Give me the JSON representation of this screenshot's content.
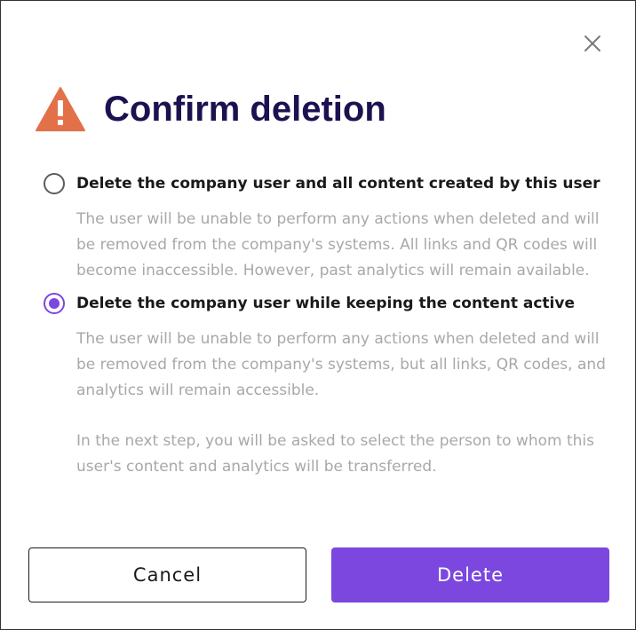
{
  "dialog": {
    "title": "Confirm deletion",
    "close_icon": "close-icon",
    "warning_icon": "warning-triangle-icon",
    "accent_color": "#7b47df",
    "warning_color": "#e2714a",
    "title_color": "#1b1250"
  },
  "options": [
    {
      "label": "Delete the company user and all content created by this user",
      "selected": false,
      "description": "The user will be unable to perform any actions when deleted and will be removed from the company's systems. All links and QR codes will become inaccessible. However, past analytics will remain available."
    },
    {
      "label": "Delete the company user while keeping the content active",
      "selected": true,
      "description": "The user will be unable to perform any actions when deleted and will be removed from the company's systems, but all links, QR codes, and analytics will remain accessible.",
      "note": "In the next step, you will be asked to select the person to whom this user's content and analytics will be transferred."
    }
  ],
  "buttons": {
    "cancel_label": "Cancel",
    "delete_label": "Delete"
  }
}
